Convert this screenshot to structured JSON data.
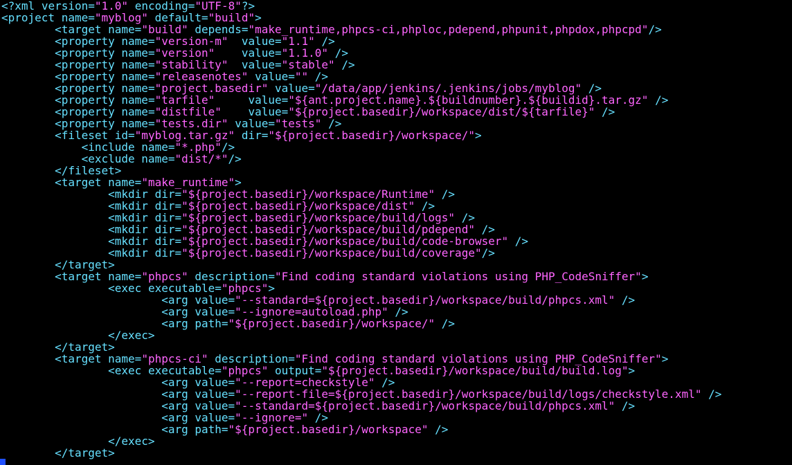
{
  "colors": {
    "background": "#000000",
    "tag": "#ff77ff",
    "attribute": "#66e0ff",
    "value": "#ff66ff",
    "cursor": "#2050ff"
  },
  "lines": [
    "<?xml version=\"1.0\" encoding=\"UTF-8\"?>",
    "<project name=\"myblog\" default=\"build\">",
    "        <target name=\"build\" depends=\"make_runtime,phpcs-ci,phploc,pdepend,phpunit,phpdox,phpcpd\"/>",
    "        <property name=\"version-m\"  value=\"1.1\" />",
    "        <property name=\"version\"    value=\"1.1.0\" />",
    "        <property name=\"stability\"  value=\"stable\" />",
    "        <property name=\"releasenotes\" value=\"\" />",
    "        <property name=\"project.basedir\" value=\"/data/app/jenkins/.jenkins/jobs/myblog\" />",
    "        <property name=\"tarfile\"     value=\"${ant.project.name}.${buildnumber}.${buildid}.tar.gz\" />",
    "        <property name=\"distfile\"    value=\"${project.basedir}/workspace/dist/${tarfile}\" />",
    "        <property name=\"tests.dir\" value=\"tests\" />",
    "        <fileset id=\"myblog.tar.gz\" dir=\"${project.basedir}/workspace/\">",
    "            <include name=\"*.php\"/>",
    "            <exclude name=\"dist/*\"/>",
    "        </fileset>",
    "        <target name=\"make_runtime\">",
    "                <mkdir dir=\"${project.basedir}/workspace/Runtime\" />",
    "                <mkdir dir=\"${project.basedir}/workspace/dist\" />",
    "                <mkdir dir=\"${project.basedir}/workspace/build/logs\" />",
    "                <mkdir dir=\"${project.basedir}/workspace/build/pdepend\" />",
    "                <mkdir dir=\"${project.basedir}/workspace/build/code-browser\" />",
    "                <mkdir dir=\"${project.basedir}/workspace/build/coverage\"/>",
    "        </target>",
    "        <target name=\"phpcs\" description=\"Find coding standard violations using PHP_CodeSniffer\">",
    "                <exec executable=\"phpcs\">",
    "                        <arg value=\"--standard=${project.basedir}/workspace/build/phpcs.xml\" />",
    "                        <arg value=\"--ignore=autoload.php\" />",
    "                        <arg path=\"${project.basedir}/workspace/\" />",
    "                </exec>",
    "        </target>",
    "        <target name=\"phpcs-ci\" description=\"Find coding standard violations using PHP_CodeSniffer\">",
    "                <exec executable=\"phpcs\" output=\"${project.basedir}/workspace/build/build.log\">",
    "                        <arg value=\"--report=checkstyle\" />",
    "                        <arg value=\"--report-file=${project.basedir}/workspace/build/logs/checkstyle.xml\" />",
    "                        <arg value=\"--standard=${project.basedir}/workspace/build/phpcs.xml\" />",
    "                        <arg value=\"--ignore=\" />",
    "                        <arg path=\"${project.basedir}/workspace\" />",
    "                </exec>",
    "        </target>"
  ]
}
